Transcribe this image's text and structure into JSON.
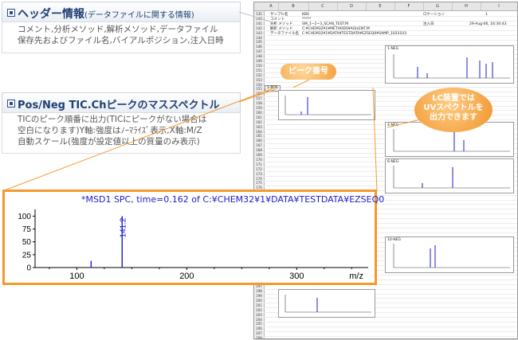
{
  "header_panel": {
    "title": "ヘッダー情報",
    "subtitle": "(データファイルに関する情報)",
    "lines": [
      "コメント,分析メソッド,解析メソッド,データファイル",
      "保存先およびファイル名,バイアルポジション,注入日時"
    ]
  },
  "spectrum_panel": {
    "title": "Pos/Neg TIC.Chピークのマススペクトル",
    "lines": [
      "TICのピーク順番に出力(TICにピークがない場合は",
      "空白になります)Y軸:強度はﾉｰﾏﾗｲｽﾞ表示,X軸:M/Z",
      "自動スケール(強度が設定値以上の質量のみ表示)"
    ]
  },
  "callouts": {
    "peak_number": "ピーク番号",
    "lc_lines": [
      "LC装置では",
      "UVスペクトルを",
      "出力できます"
    ]
  },
  "zoom": {
    "title": "*MSD1 SPC, time=0.162 of C:¥CHEM32¥1¥DATA¥TESTDATA¥EZSEQ0",
    "peak_label": "141.2",
    "x_ticks": [
      "100",
      "200",
      "300"
    ],
    "y_ticks": [
      "100",
      "75",
      "50",
      "25",
      "0"
    ],
    "x_unit": "m/z",
    "chart_data": {
      "type": "bar",
      "title": "*MSD1 SPC, time=0.162 of C:¥CHEM32¥1¥DATA¥TESTDATA¥EZSEQ0",
      "xlabel": "m/z",
      "ylabel": "",
      "xlim": [
        62,
        365
      ],
      "ylim": [
        0,
        110
      ],
      "x": [
        113,
        141.2
      ],
      "values": [
        13,
        100
      ]
    }
  },
  "sheet": {
    "columns": [
      "A",
      "B",
      "C",
      "D",
      "E",
      "F",
      "G",
      "H",
      "I"
    ],
    "rows": [
      "135",
      "140",
      "141",
      "142",
      "143",
      "144",
      "145",
      "146",
      "147",
      "148",
      "149",
      "150",
      "151",
      "152",
      "153",
      "154",
      "155",
      "156",
      "157",
      "158",
      "159",
      "160",
      "161",
      "162",
      "163",
      "164",
      "165",
      "166",
      "167",
      "168",
      "169",
      "170",
      "171",
      "172",
      "173",
      "174",
      "175",
      "176",
      "177",
      "178",
      "179",
      "180",
      "181",
      "182",
      "183",
      "184",
      "185",
      "186",
      "187",
      "188",
      "189",
      "190",
      "191",
      "192",
      "193",
      "194",
      "195",
      "196",
      "197",
      "198",
      "199",
      "200",
      "201",
      "202",
      "203",
      "204",
      "205",
      "206",
      "207",
      "208"
    ],
    "labels": {
      "sample_name": "サンプル名",
      "sample_value": "KBS",
      "comment": "コメント",
      "comment_value": "*****",
      "method": "分析 メソッド",
      "method_value": "SM_1~2~3_SCAN_TEST.M",
      "analysis_method": "解析 メソッド",
      "analysis_value": "C:¥CHEM32¥1¥METHODS¥AGILENT.M",
      "datafile": "データファイル名",
      "datafile_value": "C:¥CHEM32¥1¥DATA¥TESTDATA¥EZSEQ0¥SAMP_1033103",
      "location": "ロケーション",
      "location_value": "1",
      "injected": "注入日",
      "injected_value": "29-Aug-06, 16:30:43"
    },
    "row_tag": "1-POS",
    "mini_titles": [
      "1-NEG",
      "4-NEG",
      "6-NEG",
      "10-NEG"
    ]
  },
  "colors": {
    "accent": "#f29a2e",
    "heading": "#1f3f74",
    "spectrum": "#1c1ccd"
  }
}
